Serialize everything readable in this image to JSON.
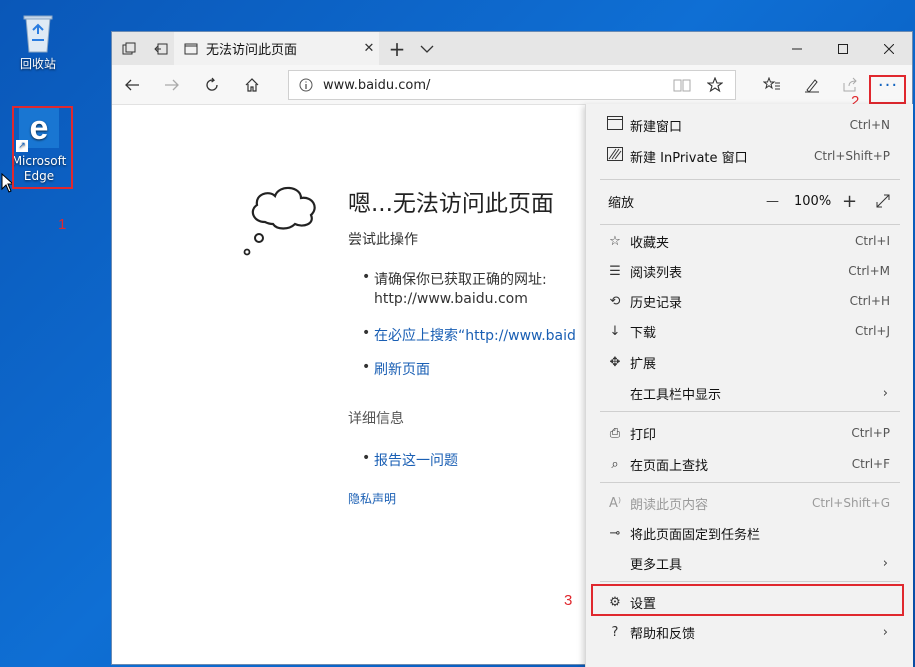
{
  "desktop": {
    "recycle_bin_label": "回收站",
    "edge_label_line1": "Microsoft",
    "edge_label_line2": "Edge"
  },
  "annotations": [
    "1",
    "2",
    "3"
  ],
  "browser": {
    "tab_title": "无法访问此页面",
    "url": "www.baidu.com/"
  },
  "page": {
    "title": "嗯...无法访问此页面",
    "try_label": "尝试此操作",
    "bullet1_line1": "请确保你已获取正确的网址:",
    "bullet1_line2": "http://www.baidu.com",
    "bullet2": "在必应上搜索“http://www.baid",
    "bullet3": "刷新页面",
    "details_label": "详细信息",
    "report_link": "报告这一问题",
    "privacy_link": "隐私声明"
  },
  "menu": {
    "new_window": "新建窗口",
    "new_window_sc": "Ctrl+N",
    "new_inprivate": "新建 InPrivate 窗口",
    "new_inprivate_sc": "Ctrl+Shift+P",
    "zoom_label": "缩放",
    "zoom_minus": "—",
    "zoom_value": "100%",
    "zoom_plus": "+",
    "favorites": "收藏夹",
    "favorites_sc": "Ctrl+I",
    "reading_list": "阅读列表",
    "reading_list_sc": "Ctrl+M",
    "history": "历史记录",
    "history_sc": "Ctrl+H",
    "downloads": "下载",
    "downloads_sc": "Ctrl+J",
    "extensions": "扩展",
    "show_in_toolbar": "在工具栏中显示",
    "print": "打印",
    "print_sc": "Ctrl+P",
    "find_on_page": "在页面上查找",
    "find_on_page_sc": "Ctrl+F",
    "read_aloud": "朗读此页内容",
    "read_aloud_sc": "Ctrl+Shift+G",
    "pin_taskbar": "将此页面固定到任务栏",
    "more_tools": "更多工具",
    "settings": "设置",
    "help_feedback": "帮助和反馈"
  }
}
